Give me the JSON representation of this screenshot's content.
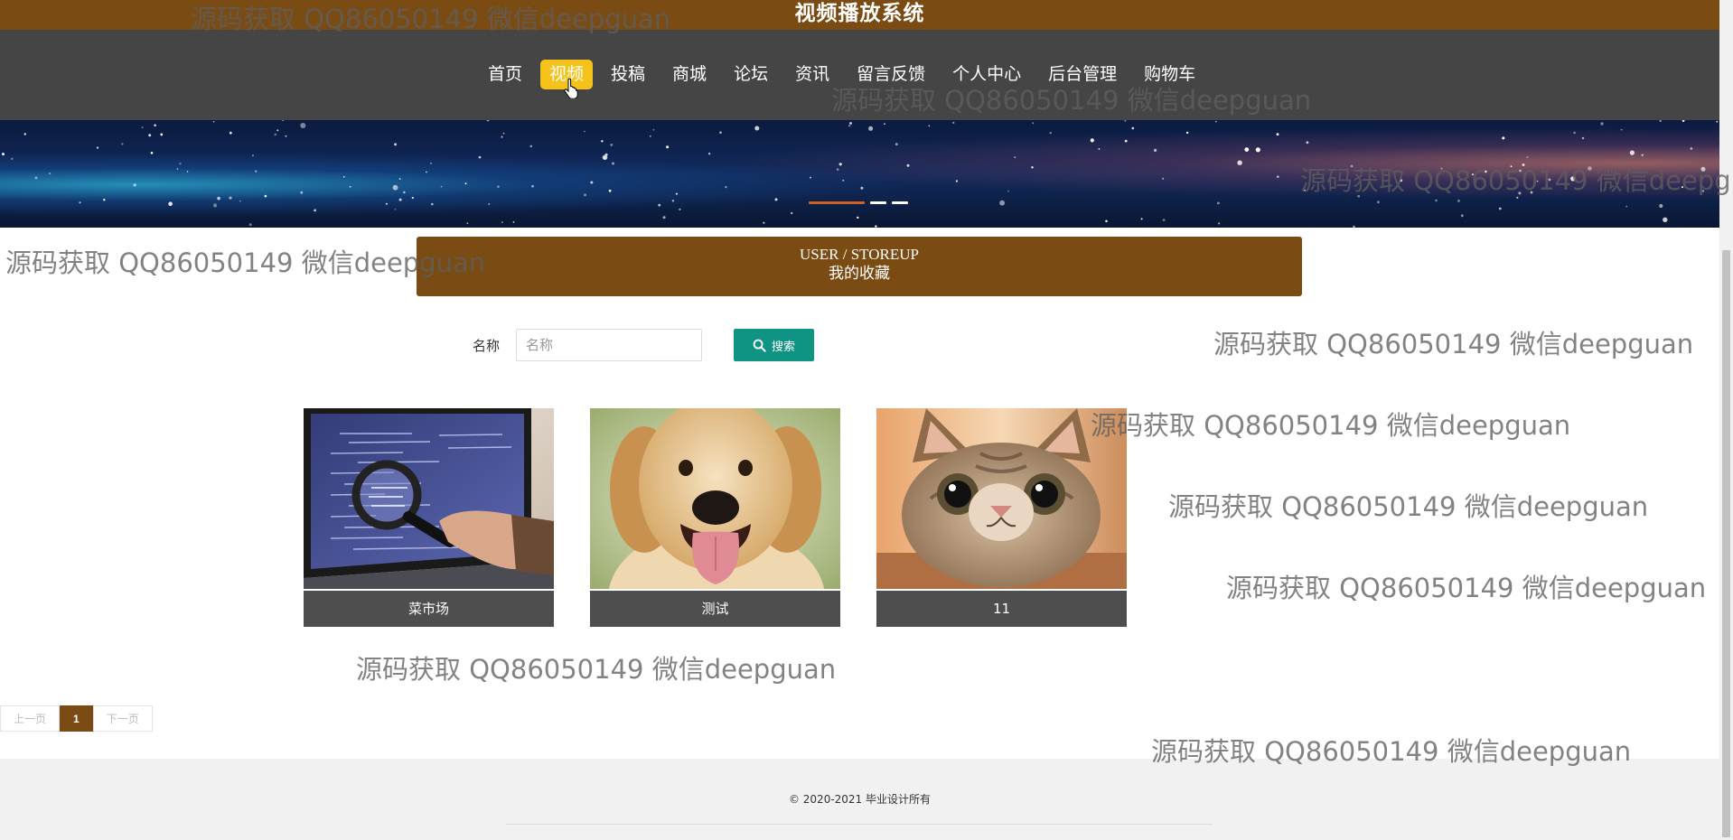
{
  "header": {
    "title": "视频播放系统"
  },
  "nav": {
    "items": [
      {
        "label": "首页",
        "active": false
      },
      {
        "label": "视频",
        "active": true
      },
      {
        "label": "投稿",
        "active": false
      },
      {
        "label": "商城",
        "active": false
      },
      {
        "label": "论坛",
        "active": false
      },
      {
        "label": "资讯",
        "active": false
      },
      {
        "label": "留言反馈",
        "active": false
      },
      {
        "label": "个人中心",
        "active": false
      },
      {
        "label": "后台管理",
        "active": false
      },
      {
        "label": "购物车",
        "active": false
      }
    ]
  },
  "banner": {
    "slide_count": 3,
    "active_slide": 0
  },
  "section": {
    "title_en": "USER / STOREUP",
    "title_cn": "我的收藏"
  },
  "search": {
    "label": "名称",
    "placeholder": "名称",
    "value": "",
    "button_label": "搜索",
    "button_icon": "search-icon"
  },
  "cards": [
    {
      "title": "菜市场",
      "image": "laptop-magnifier-photo"
    },
    {
      "title": "测试",
      "image": "golden-retriever-photo"
    },
    {
      "title": "11",
      "image": "tabby-cat-photo"
    }
  ],
  "pagination": {
    "prev_label": "上一页",
    "current_page": "1",
    "next_label": "下一页"
  },
  "footer": {
    "copyright": "© 2020-2021 毕业设计所有"
  },
  "watermark": {
    "text": "源码获取 QQ86050149 微信deepguan",
    "count": 10
  },
  "colors": {
    "brand_brown": "#7a4b13",
    "nav_background": "#454545",
    "active_nav": "#f4c21a",
    "search_button": "#0f9484",
    "card_caption": "#4e4e4e",
    "footer_background": "#f1f1f1"
  }
}
